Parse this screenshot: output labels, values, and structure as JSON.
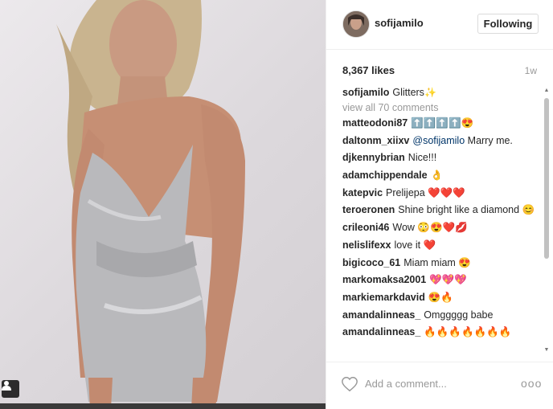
{
  "post": {
    "username": "sofijamilo",
    "follow_label": "Following",
    "likes": "8,367 likes",
    "time": "1w",
    "caption_text": "Glitters",
    "caption_emoji": "✨",
    "view_all": "view all 70 comments"
  },
  "comments": [
    {
      "user": "matteodoni87",
      "text": "⬆️⬆️⬆️⬆️😍"
    },
    {
      "user": "daltonm_xiixv",
      "mention": "@sofijamilo",
      "text": "Marry me."
    },
    {
      "user": "djkennybrian",
      "text": "Nice!!!"
    },
    {
      "user": "adamchippendale",
      "text": "👌"
    },
    {
      "user": "katepvic",
      "text": "Prelijepa ❤️❤️❤️"
    },
    {
      "user": "teroeronen",
      "text": "Shine bright like a diamond 😊"
    },
    {
      "user": "crileoni46",
      "text": "Wow 😳😍❤️💋"
    },
    {
      "user": "nelislifexx",
      "text": "love it ❤️"
    },
    {
      "user": "bigicoco_61",
      "text": "Miam miam 😍"
    },
    {
      "user": "markomaksa2001",
      "text": "💖💖💖"
    },
    {
      "user": "markiemarkdavid",
      "text": "😍🔥"
    },
    {
      "user": "amandalinneas_",
      "text": "Omggggg babe"
    },
    {
      "user": "amandalinneas_",
      "text": "🔥🔥🔥🔥🔥🔥🔥"
    }
  ],
  "comment_input": {
    "placeholder": "Add a comment..."
  },
  "more_label": "ooo",
  "colors": {
    "accent": "#003569",
    "heart": "#e0171b",
    "muted": "#999999"
  },
  "icons": {
    "like": "heart-outline-icon",
    "more": "ellipsis-icon",
    "tag": "user-tag-icon"
  }
}
